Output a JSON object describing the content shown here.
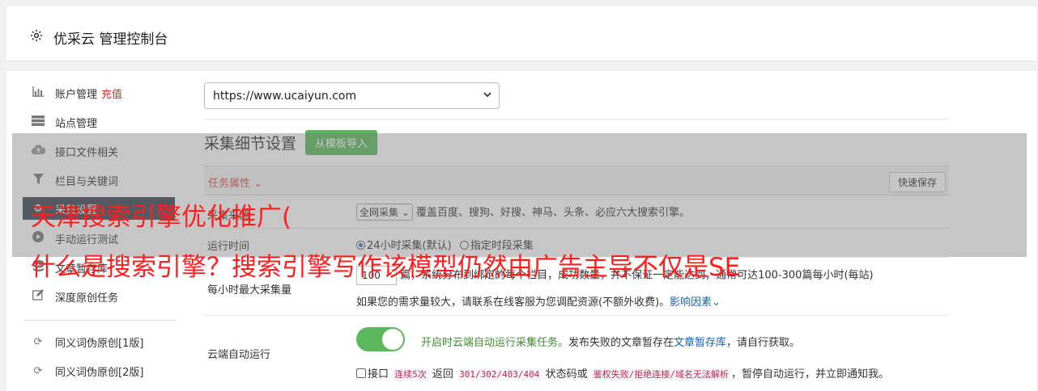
{
  "header": {
    "title": "优采云 管理控制台",
    "icon": "gear-icon"
  },
  "sidebar": {
    "items": [
      {
        "label": "账户管理",
        "badge": "充值",
        "icon": "bar-chart-icon"
      },
      {
        "label": "站点管理",
        "icon": "server-icon"
      },
      {
        "label": "接口文件相关",
        "icon": "cloud-upload-icon"
      },
      {
        "label": "栏目与关键词",
        "icon": "filter-icon"
      },
      {
        "label": "采集设置",
        "icon": "cogs-icon"
      },
      {
        "label": "手动运行测试",
        "icon": "play-circle-icon"
      },
      {
        "label": "文章暂存库",
        "icon": "database-icon"
      },
      {
        "label": "深度原创任务",
        "icon": "edit-icon"
      },
      {
        "label": "同义词伪原创[1版]",
        "icon": "refresh-icon"
      },
      {
        "label": "同义词伪原创[2版]",
        "icon": "refresh-icon"
      }
    ]
  },
  "site_select": {
    "value": "https://www.ucaiyun.com"
  },
  "section": {
    "title": "采集细节设置",
    "template_button": "从模板导入"
  },
  "task_bar": {
    "attr_label": "任务属性",
    "save_button": "快速保存"
  },
  "rows": {
    "source": {
      "label": "采集来源",
      "select": "全网采集",
      "desc": "覆盖百度、搜狗、好搜、神马、头条、必应六大搜索引擎。"
    },
    "run_time": {
      "label": "运行时间",
      "option1": "24小时采集(默认)",
      "option2": "指定时段采集"
    },
    "max_per_hour": {
      "label": "每小时最大采集量",
      "value": "100",
      "desc1": "篇，系统分布到绑定的每个栏目，成功数量，并不保证一定能达到，通常可达100-300篇每小时(每站)",
      "desc2": "如果您的需求量较大，请联系在线客服为您调配资源(不额外收费)。",
      "link": "影响因素"
    },
    "cloud_run": {
      "label": "云端自动运行",
      "toggle_desc": "开启时云端自动运行采集任务。",
      "desc_rest": "发布失败的文章暂存在",
      "link": "文章暂存库",
      "desc_end": "，请自行获取。",
      "check_label": "接口",
      "code1": "连续5次",
      "mid1": "返回",
      "code2": "301/302/403/404",
      "mid2": "状态码或",
      "code3": "鉴权失败/拒绝连接/域名无法解析",
      "tail": "，暂停自动运行，并立即通知我。"
    }
  },
  "overlay": {
    "line1": "天津搜索引擎优化推广(",
    "line2": "什么是搜索引擎？搜索引擎写作该模型仍然由广告主导不仅是SE"
  },
  "colors": {
    "accent_green": "#5cb85c",
    "active_nav": "#3b4552",
    "red_text": "#ff1e1e"
  }
}
